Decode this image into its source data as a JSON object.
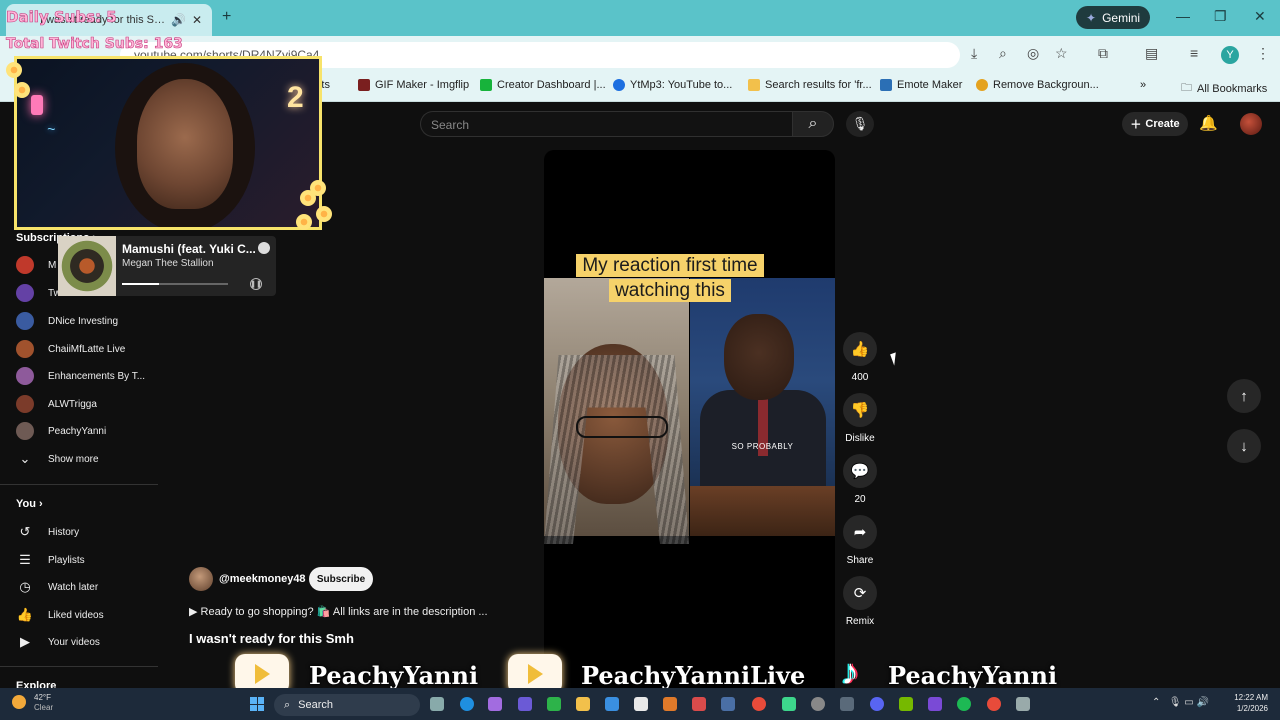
{
  "browser": {
    "tab_title": "I wasn't ready for this Smh",
    "url": "youtube.com/shorts/DR4NZyj9Ca4",
    "gemini_label": "Gemini",
    "profile_initial": "Y",
    "bookmarks": [
      {
        "label": "ments",
        "color": "#d14242"
      },
      {
        "label": "GIF Maker - Imgflip",
        "color": "#7a1f1f"
      },
      {
        "label": "Creator Dashboard |...",
        "color": "#17b33b"
      },
      {
        "label": "YtMp3: YouTube to...",
        "color": "#1d6fe0"
      },
      {
        "label": "Search results for 'fr...",
        "color": "#f2c04b"
      },
      {
        "label": "Emote Maker",
        "color": "#2b6fb5"
      },
      {
        "label": "Remove Backgroun...",
        "color": "#e4a21f"
      }
    ],
    "all_bookmarks": "All Bookmarks"
  },
  "stream_overlay": {
    "daily_subs": "Daily Subs: 5",
    "total_subs": "Total Twitch Subs: 163",
    "spotify": {
      "song": "Mamushi (feat. Yuki C...",
      "artist": "Megan Thee Stallion",
      "progress": 0.35
    },
    "socials": [
      {
        "platform": "youtube",
        "handle": "PeachyYanni"
      },
      {
        "platform": "youtube",
        "handle": "PeachyYanniLive"
      },
      {
        "platform": "tiktok",
        "handle": "PeachyYanni"
      }
    ],
    "tiktok_glyph": "♪"
  },
  "youtube": {
    "search_placeholder": "Search",
    "create_label": "Create",
    "sidebar": {
      "subscriptions_header": "Subscriptions",
      "subscriptions": [
        {
          "label": "M",
          "color": "#c0392b"
        },
        {
          "label": "Tw",
          "color": "#6441a5"
        },
        {
          "label": "DNice Investing",
          "color": "#3a5ba0"
        },
        {
          "label": "ChaiiMfLatte Live",
          "color": "#a0522d"
        },
        {
          "label": "Enhancements By T...",
          "color": "#8e5a9b"
        },
        {
          "label": "ALWTrigga",
          "color": "#7b3b2a"
        },
        {
          "label": "PeachyYanni",
          "color": "#6e5a54"
        }
      ],
      "show_more": "Show more",
      "you_header": "You",
      "you_items": [
        {
          "label": "History",
          "icon": "history-icon"
        },
        {
          "label": "Playlists",
          "icon": "playlists-icon"
        },
        {
          "label": "Watch later",
          "icon": "watch-later-icon"
        },
        {
          "label": "Liked videos",
          "icon": "liked-videos-icon"
        },
        {
          "label": "Your videos",
          "icon": "your-videos-icon"
        }
      ],
      "explore_header": "Explore"
    },
    "short": {
      "caption": "My reaction first time watching this",
      "subtitle": "SO PROBABLY",
      "likes": "400",
      "dislike_label": "Dislike",
      "comments": "20",
      "share_label": "Share",
      "remix_label": "Remix"
    },
    "channel": {
      "handle": "@meekmoney48",
      "subscribe_label": "Subscribe",
      "description": "▶ Ready to go shopping? 🛍️ All links are in the description ...",
      "title": "I wasn't ready for this Smh"
    }
  },
  "taskbar": {
    "weather_temp": "42°F",
    "weather_cond": "Clear",
    "search_label": "Search",
    "time": "12:22 AM",
    "date": "1/2/2026"
  }
}
